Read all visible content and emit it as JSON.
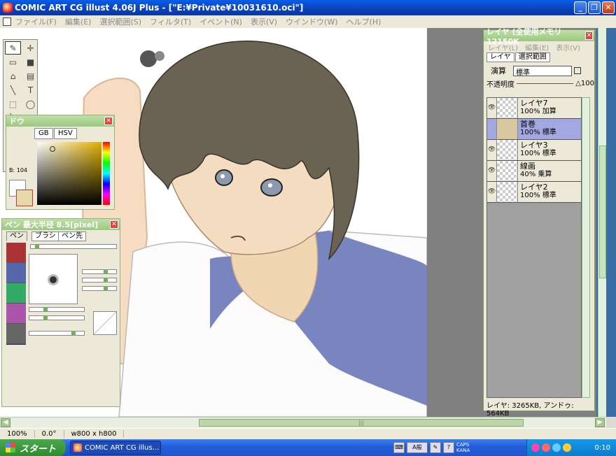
{
  "window": {
    "title": "COMIC ART CG illust 4.06J Plus - [\"E:¥Private¥10031610.oci\"]",
    "min_icon": "_",
    "restore_icon": "❐",
    "close_icon": "✕"
  },
  "menu": [
    "ファイル(F)",
    "編集(E)",
    "選択範囲(S)",
    "フィルタ(T)",
    "イベント(N)",
    "表示(V)",
    "ウインドウ(W)",
    "ヘルプ(H)"
  ],
  "tools": [
    "✎",
    "✛",
    "▭",
    "■",
    "⌂",
    "▤",
    "╲",
    "T",
    "⬚",
    "◯",
    "╲",
    "T",
    "ꝭ",
    "⊿",
    "✋",
    "⌕",
    "⊕",
    "⊖"
  ],
  "color_window": {
    "title_partial": "ドウ",
    "tab_rgb": "GB",
    "tab_hsv": "HSV",
    "b_value": "B: 104",
    "close": "✕"
  },
  "pen_window": {
    "title": "ペン 最大半径 8.5[pixel]",
    "tabs": [
      "ペン",
      "ブラシ",
      "ペン先"
    ],
    "close": "✕"
  },
  "layer_window": {
    "title": "レイヤ (全使用メモリ 12150K",
    "menu": [
      "レイヤ(L)",
      "編集(E)",
      "表示(V)"
    ],
    "tabs": [
      "レイヤ",
      "選択範囲"
    ],
    "blend_label": "演算",
    "blend_value": "標準",
    "opacity_label": "不透明度",
    "opacity_value": "△100",
    "layers": [
      {
        "name": "レイヤ7",
        "info": "100% 加算",
        "selected": false,
        "visible": true
      },
      {
        "name": "首巻",
        "info": "100% 標準",
        "selected": true,
        "visible": false
      },
      {
        "name": "レイヤ3",
        "info": "100% 標準",
        "selected": false,
        "visible": true
      },
      {
        "name": "線画",
        "info": "40% 乗算",
        "selected": false,
        "visible": true
      },
      {
        "name": "レイヤ2",
        "info": "100% 標準",
        "selected": false,
        "visible": true
      }
    ],
    "footer": "レイヤ: 3265KB, アンドゥ: 564KB",
    "close": "✕"
  },
  "status": {
    "zoom": "100%",
    "angle": "0.0°",
    "size": "w800 x h800"
  },
  "taskbar": {
    "start": "スタート",
    "task": "COMIC ART CG illus...",
    "ime": "A般",
    "caps": "CAPS",
    "kana": "KANA",
    "time": "0:10"
  },
  "scroll_grip": "|||",
  "colors": {
    "accent": "#0a5ee8",
    "selected_layer": "#a4a8e0",
    "palette_header": "#9cc880"
  }
}
